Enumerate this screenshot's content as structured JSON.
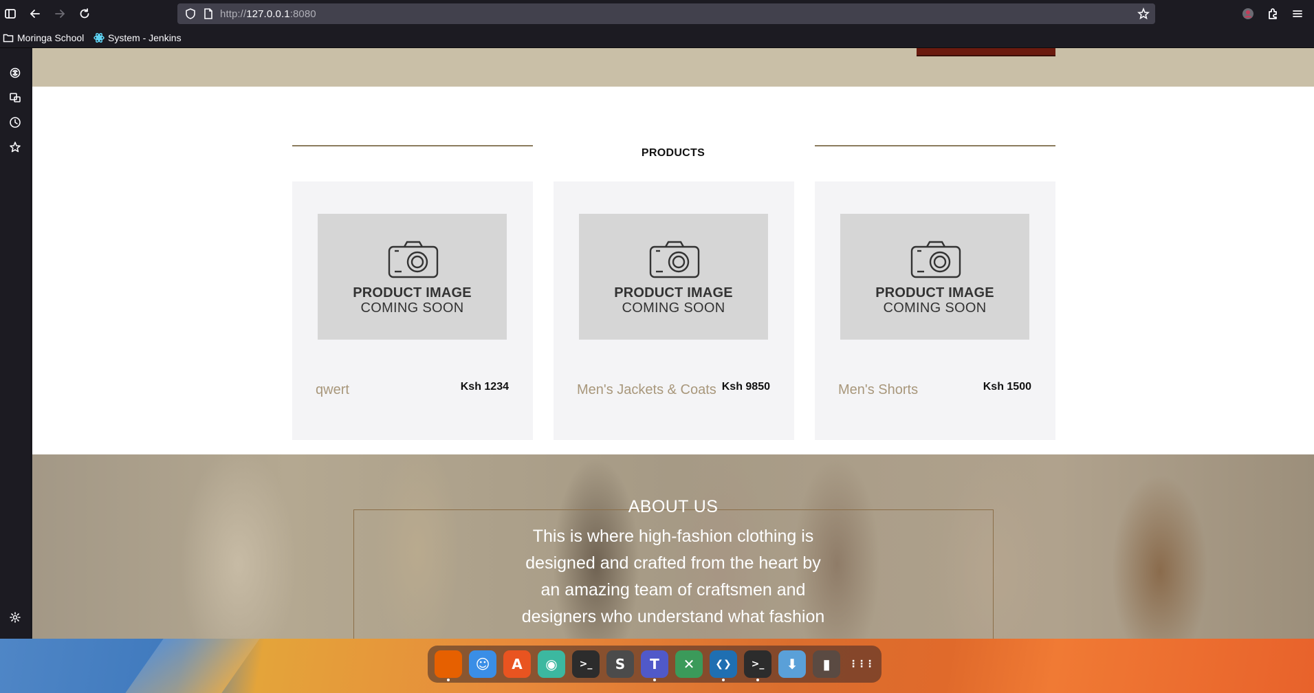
{
  "browser": {
    "url_prefix": "http://",
    "url_host": "127.0.0.1",
    "url_port": ":8080",
    "bookmarks": [
      {
        "label": "Moringa School",
        "icon": "folder-icon"
      },
      {
        "label": "System - Jenkins",
        "icon": "react-favicon-icon"
      }
    ],
    "sidebar_icons": [
      "ai-chatbot-icon",
      "tab-sync-icon",
      "history-icon",
      "bookmarks-star-icon",
      "settings-gear-icon"
    ]
  },
  "page": {
    "products_title": "PRODUCTS",
    "products": [
      {
        "name": "qwert",
        "price": "Ksh 1234",
        "placeholder_line1": "PRODUCT IMAGE",
        "placeholder_line2": "COMING SOON"
      },
      {
        "name": "Men's Jackets & Coats",
        "price": "Ksh 9850",
        "placeholder_line1": "PRODUCT IMAGE",
        "placeholder_line2": "COMING SOON"
      },
      {
        "name": "Men's Shorts",
        "price": "Ksh 1500",
        "placeholder_line1": "PRODUCT IMAGE",
        "placeholder_line2": "COMING SOON"
      }
    ],
    "about_title": "ABOUT US",
    "about_text": "This is where high-fashion clothing is designed and crafted from the heart by an amazing team of craftsmen and designers who understand what fashion"
  },
  "dock": {
    "apps": [
      {
        "name": "firefox",
        "glyph": "",
        "color": "#e66000",
        "running": true
      },
      {
        "name": "files",
        "glyph": "☺",
        "color": "#3a8ee6",
        "running": false
      },
      {
        "name": "app-center",
        "glyph": "A",
        "color": "#e95420",
        "running": false
      },
      {
        "name": "network-tool",
        "glyph": "◉",
        "color": "#3cb8a0",
        "running": false
      },
      {
        "name": "terminal",
        "glyph": ">_",
        "color": "#2c2c2c",
        "running": false
      },
      {
        "name": "sublime-text",
        "glyph": "S",
        "color": "#4b4b4b",
        "running": false
      },
      {
        "name": "teams-for-linux",
        "glyph": "T",
        "color": "#5059c9",
        "running": true
      },
      {
        "name": "remote-desktop",
        "glyph": "✕",
        "color": "#3b9a5a",
        "running": false
      },
      {
        "name": "vscode",
        "glyph": "❮❯",
        "color": "#1f6fb2",
        "running": true
      },
      {
        "name": "terminal-2",
        "glyph": ">_",
        "color": "#2c2c2c",
        "running": true
      },
      {
        "name": "downloads-folder",
        "glyph": "⬇",
        "color": "#5aa0d8",
        "running": false
      },
      {
        "name": "trash",
        "glyph": "▮",
        "color": "#5a4a42",
        "running": false
      },
      {
        "name": "show-apps",
        "glyph": "⋮⋮⋮",
        "color": "transparent",
        "running": false
      }
    ]
  }
}
